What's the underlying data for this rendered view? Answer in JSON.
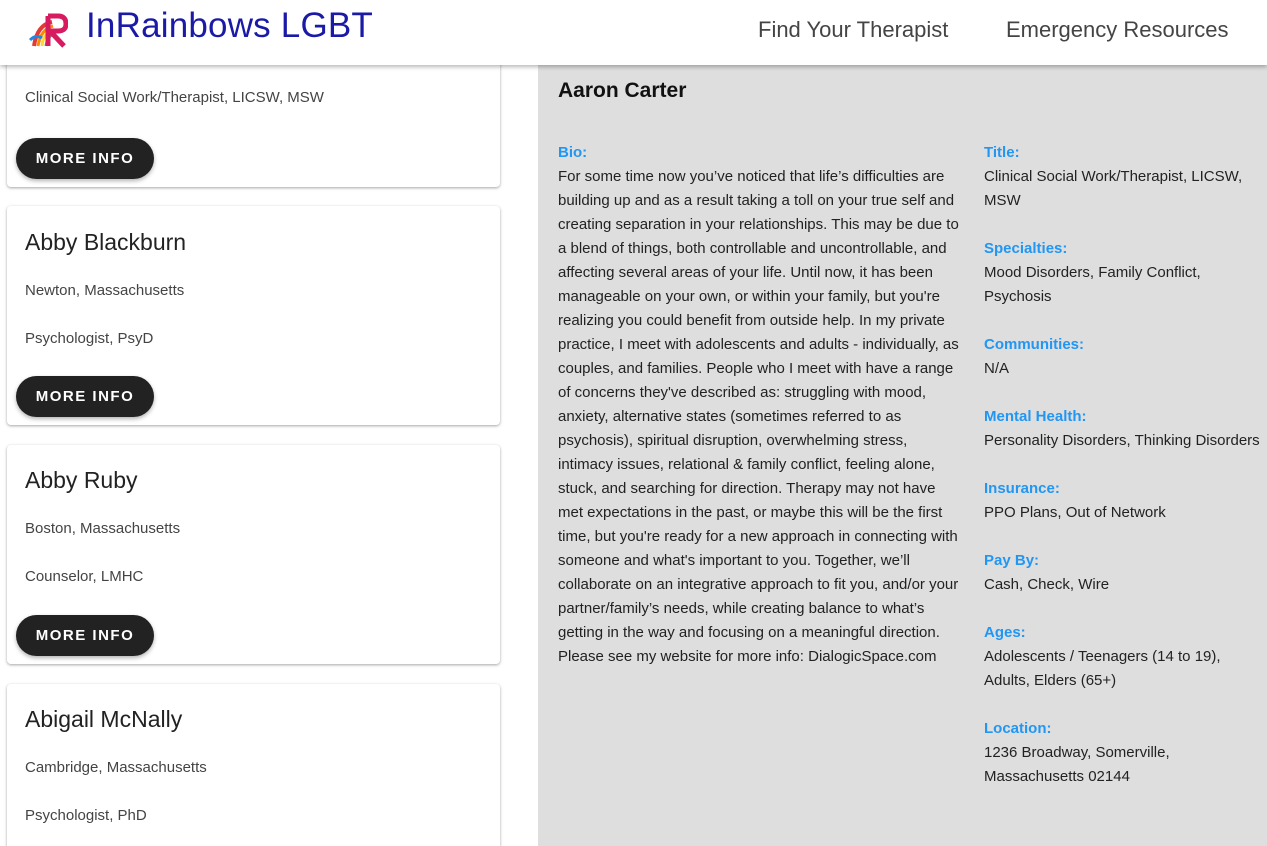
{
  "header": {
    "brand": "InRainbows LGBT",
    "logo_icon": "rainbow-r-logo",
    "nav": {
      "find_therapist": "Find Your Therapist",
      "emergency": "Emergency Resources"
    }
  },
  "list": {
    "button_label": "MORE INFO",
    "cards": [
      {
        "name": "",
        "location": "",
        "title": "Clinical Social Work/Therapist, LICSW, MSW"
      },
      {
        "name": "Abby Blackburn",
        "location": "Newton, Massachusetts",
        "title": "Psychologist, PsyD"
      },
      {
        "name": "Abby Ruby",
        "location": "Boston, Massachusetts",
        "title": "Counselor, LMHC"
      },
      {
        "name": "Abigail McNally",
        "location": "Cambridge, Massachusetts",
        "title": "Psychologist, PhD"
      }
    ]
  },
  "detail": {
    "name": "Aaron Carter",
    "bio_label": "Bio:",
    "bio": "For some time now you’ve noticed that life’s difficulties are building up and as a result taking a toll on your true self and creating separation in your relationships. This may be due to a blend of things, both controllable and uncontrollable, and affecting several areas of your life. Until now, it has been manageable on your own, or within your family, but you're realizing you could benefit from outside help. In my private practice, I meet with adolescents and adults - individually, as couples, and families. People who I meet with have a range of concerns they've described as: struggling with mood, anxiety, alternative states (sometimes referred to as psychosis), spiritual disruption, overwhelming stress, intimacy issues, relational & family conflict, feeling alone, stuck, and searching for direction. Therapy may not have met expectations in the past, or maybe this will be the first time, but you're ready for a new approach in connecting with someone and what's important to you. Together, we’ll collaborate on an integrative approach to fit you, and/or your partner/family’s needs, while creating balance to what’s getting in the way and focusing on a meaningful direction. Please see my website for more info: DialogicSpace.com",
    "fields": [
      {
        "label": "Title:",
        "value": "Clinical Social Work/Therapist, LICSW, MSW"
      },
      {
        "label": "Specialties:",
        "value": "Mood Disorders, Family Conflict, Psychosis"
      },
      {
        "label": "Communities:",
        "value": "N/A"
      },
      {
        "label": "Mental Health:",
        "value": "Personality Disorders, Thinking Disorders"
      },
      {
        "label": "Insurance:",
        "value": "PPO Plans, Out of Network"
      },
      {
        "label": "Pay By:",
        "value": "Cash, Check, Wire"
      },
      {
        "label": "Ages:",
        "value": "Adolescents / Teenagers (14 to 19), Adults, Elders (65+)"
      },
      {
        "label": "Location:",
        "value": "1236 Broadway, Somerville, Massachusetts 02144"
      }
    ]
  },
  "colors": {
    "brand": "#1a1aa6",
    "accent_label": "#2196f3",
    "button": "#222222",
    "detail_bg": "#dedede"
  }
}
